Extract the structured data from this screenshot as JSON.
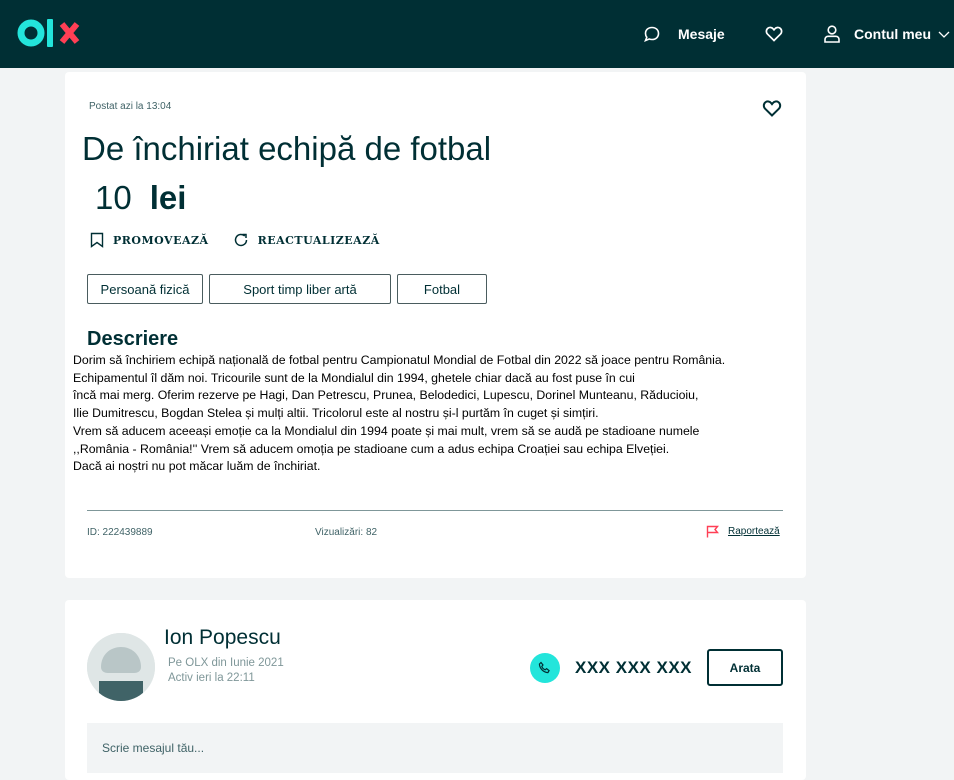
{
  "header": {
    "logo_text": "olx",
    "messages_label": "Mesaje",
    "account_label": "Contul meu",
    "colors": {
      "background": "#002f34",
      "logo_teal": "#23e5db",
      "text": "#ffffff"
    }
  },
  "ad": {
    "posted": "Postat azi la 13:04",
    "title": "De închiriat echipă de fotbal",
    "price_value": "10",
    "price_currency": "lei",
    "promote_label": "PROMOVEAZĂ",
    "refresh_label": "REACTUALIZEAZĂ",
    "tags": [
      "Persoană fizică",
      "Sport timp liber artă",
      "Fotbal"
    ],
    "description_heading": "Descriere",
    "description_lines": [
      "Dorim să închiriem echipă națională de fotbal pentru Campionatul Mondial de Fotbal din 2022 să joace pentru România.",
      "Echipamentul îl dăm noi. Tricourile sunt de la Mondialul din 1994, ghetele chiar dacă au fost puse în cui",
      "încă mai merg. Oferim rezerve pe Hagi, Dan Petrescu, Prunea, Belodedici, Lupescu, Dorinel Munteanu, Răducioiu,",
      "Ilie Dumitrescu, Bogdan Stelea și mulți altii. Tricolorul este al nostru și-l purtăm în cuget și simțiri.",
      "Vrem să aducem aceeași emoție ca la Mondialul din 1994 poate și mai mult, vrem să se audă pe stadioane numele",
      ",,România - România!'' Vrem să aducem omoția pe stadioane cum a adus echipa Croației sau echipa Elveției.",
      "Dacă ai noștri nu pot măcar luăm de închiriat."
    ],
    "id_text": "ID: 222439889",
    "views_text": "Vizualizări: 82",
    "report_label": "Raportează",
    "report_color": "#ff3f55"
  },
  "seller": {
    "name": "Ion Popescu",
    "member_since": "Pe OLX din Iunie 2021",
    "last_active": "Activ ieri la 22:11",
    "phone_masked": "XXX XXX XXX",
    "show_button": "Arata",
    "message_placeholder": "Scrie mesajul tău...",
    "phone_icon_color": "#23e5db"
  }
}
